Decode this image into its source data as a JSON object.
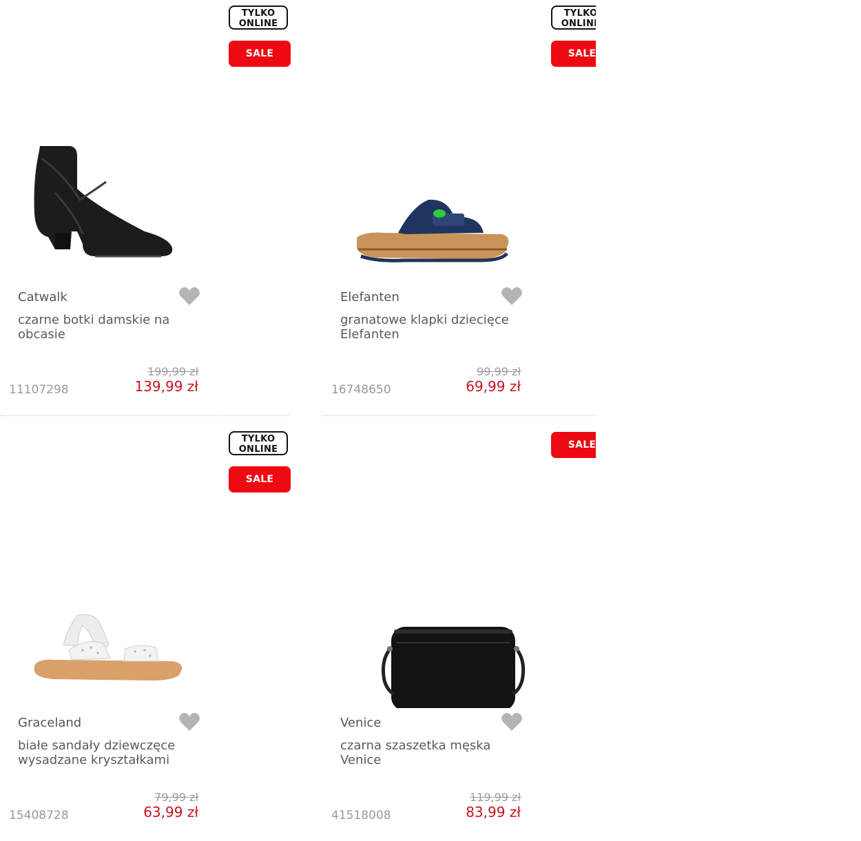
{
  "products": [
    {
      "badge_online": [
        "TYLKO",
        "ONLINE"
      ],
      "badge_sale": "SALE",
      "image_icon": "ankle-boot-image",
      "brand": "Catwalk",
      "title": "czarne botki damskie na obcasie",
      "sku": "11107298",
      "old_price": "199,99 zł",
      "price": "139,99 zł"
    },
    {
      "badge_online": [
        "TYLKO",
        "ONLINE"
      ],
      "badge_sale": "SALE",
      "image_icon": "slide-sandal-image",
      "brand": "Elefanten",
      "title": "granatowe klapki dziecięce Elefanten",
      "sku": "16748650",
      "old_price": "99,99 zł",
      "price": "69,99 zł"
    },
    {
      "badge_online": [
        "TYLKO",
        "ONLINE"
      ],
      "badge_sale": "SALE",
      "image_icon": "strap-sandal-image",
      "brand": "Graceland",
      "title": "białe sandały dziewczęce wysadzane kryształkami",
      "sku": "15408728",
      "old_price": "79,99 zł",
      "price": "63,99 zł"
    },
    {
      "badge_sale": "SALE",
      "image_icon": "crossbody-bag-image",
      "brand": "Venice",
      "title": "czarna szaszetka męska Venice",
      "sku": "41518008",
      "old_price": "119,99 zł",
      "price": "83,99 zł"
    }
  ],
  "colors": {
    "sale_red": "#ee0a12",
    "price_red": "#c8141e",
    "heart_gray": "#b4b4b4"
  }
}
